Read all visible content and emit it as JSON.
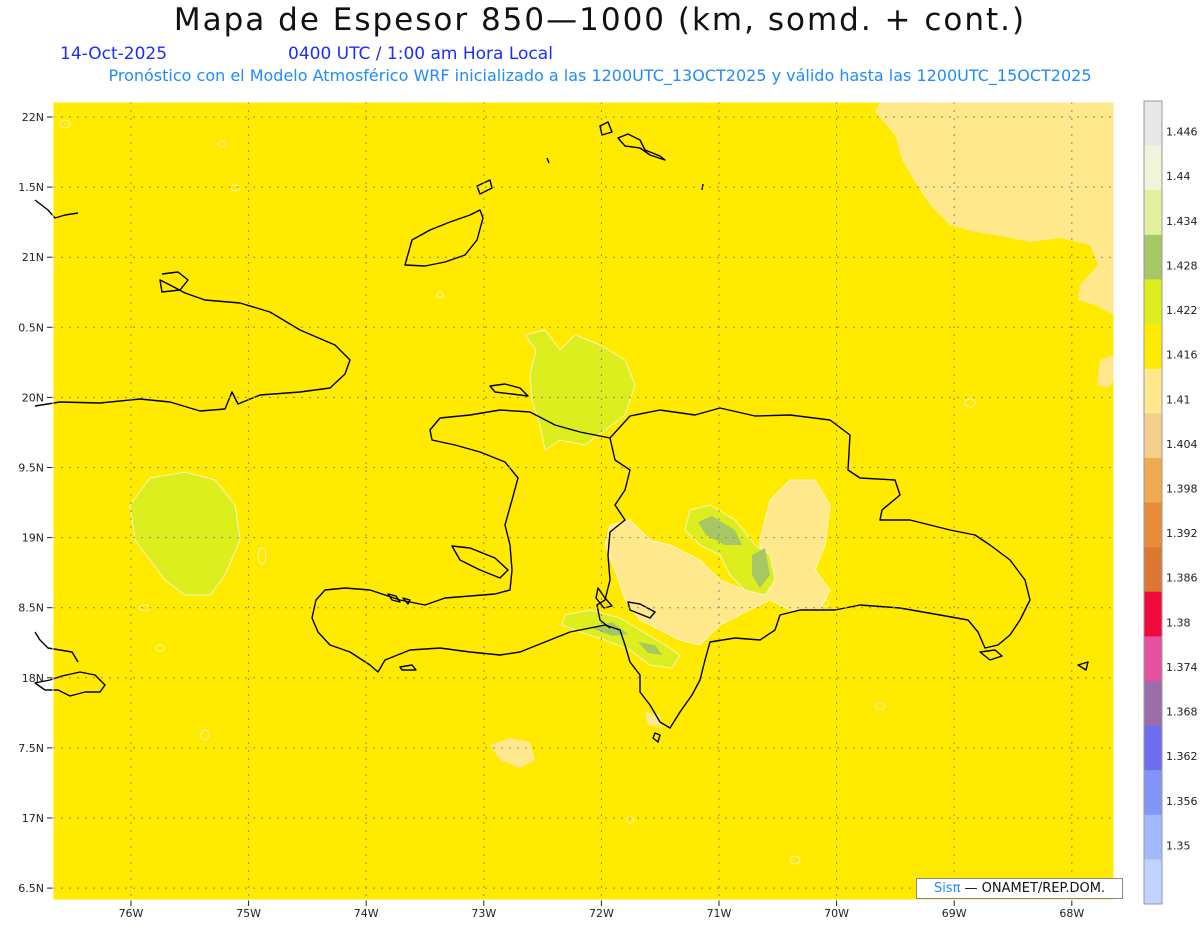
{
  "header": {
    "title": "Mapa de Espesor 850—1000 (km, somd. + cont.)",
    "date": "14-Oct-2025",
    "time": "0400 UTC / 1:00 am Hora Local",
    "info": "Pronóstico con el Modelo Atmosférico WRF inicializado a las 1200UTC_13OCT2025 y válido hasta las  1200UTC_15OCT2025"
  },
  "map": {
    "background_color": "#ffea00",
    "lat_labels": [
      "22N",
      "1.5N",
      "21N",
      "0.5N",
      "20N",
      "9.5N",
      "19N",
      "8.5N",
      "18N",
      "7.5N",
      "17N",
      "6.5N"
    ],
    "lon_labels": [
      "76W",
      "75W",
      "74W",
      "73W",
      "72W",
      "71W",
      "70W",
      "69W",
      "68W"
    ]
  },
  "colorbar": {
    "labels": [
      "1.446",
      "1.44",
      "1.434",
      "1.428",
      "1.422",
      "1.416",
      "1.41",
      "1.404",
      "1.398",
      "1.392",
      "1.386",
      "1.38",
      "1.374",
      "1.368",
      "1.362",
      "1.356",
      "1.35"
    ],
    "colors": [
      "#e8e8e8",
      "#eef5d8",
      "#e3f0a0",
      "#a6c864",
      "#dcee1e",
      "#ffea00",
      "#ffe98c",
      "#f4d08c",
      "#f0aa50",
      "#e88c3c",
      "#dc7832",
      "#f00a3c",
      "#e650a0",
      "#9b6eaa",
      "#6e6ef0",
      "#8296fa",
      "#a0b9ff",
      "#c0d2ff"
    ]
  },
  "credit": {
    "brand": "Sisπ",
    "text": " — ONAMET/REP.DOM."
  }
}
